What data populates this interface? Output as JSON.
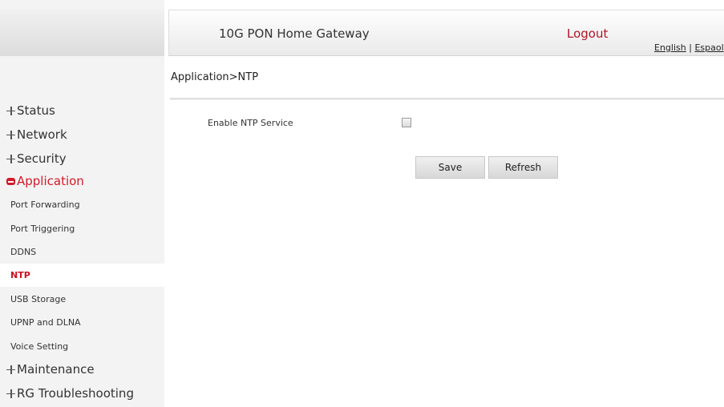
{
  "header": {
    "title": "10G PON Home Gateway",
    "logout": "Logout",
    "lang_english": "English",
    "lang_separator": " | ",
    "lang_espanol": "Espaol"
  },
  "breadcrumb": "Application>NTP",
  "sidebar": {
    "status": "Status",
    "network": "Network",
    "security": "Security",
    "application": "Application",
    "port_forwarding": "Port Forwarding",
    "port_triggering": "Port Triggering",
    "ddns": "DDNS",
    "ntp": "NTP",
    "usb_storage": "USB Storage",
    "upnp_dlna": "UPNP and DLNA",
    "voice_setting": "Voice Setting",
    "maintenance": "Maintenance",
    "rg_troubleshooting": "RG Troubleshooting"
  },
  "form": {
    "enable_ntp_label": "Enable NTP Service",
    "enable_ntp_checked": false
  },
  "buttons": {
    "save": "Save",
    "refresh": "Refresh"
  },
  "colors": {
    "accent": "#d21a2a",
    "selected_text": "#cc1122",
    "logout": "#b01626"
  },
  "icons": {
    "collapsed": "plus-icon",
    "expanded": "minus-icon"
  }
}
